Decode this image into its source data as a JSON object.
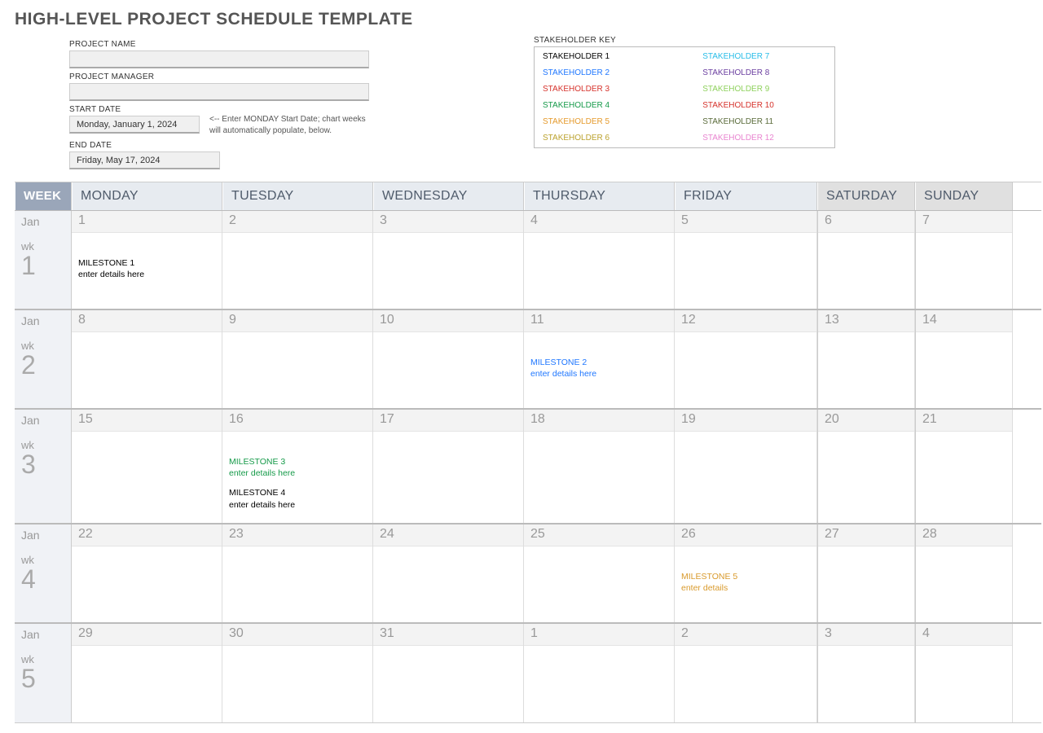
{
  "title": "HIGH-LEVEL PROJECT SCHEDULE TEMPLATE",
  "fields": {
    "project_name_label": "PROJECT NAME",
    "project_name_value": "",
    "project_manager_label": "PROJECT MANAGER",
    "project_manager_value": "",
    "start_date_label": "START DATE",
    "start_date_value": "Monday, January 1, 2024",
    "start_date_hint": "<-- Enter MONDAY Start Date; chart weeks will automatically populate, below.",
    "end_date_label": "END DATE",
    "end_date_value": "Friday, May 17, 2024"
  },
  "stakeholder_key": {
    "label": "STAKEHOLDER KEY",
    "items": [
      {
        "label": "STAKEHOLDER 1",
        "color": "#000000"
      },
      {
        "label": "STAKEHOLDER 2",
        "color": "#1f77ff"
      },
      {
        "label": "STAKEHOLDER 3",
        "color": "#d6332c"
      },
      {
        "label": "STAKEHOLDER 4",
        "color": "#159a49"
      },
      {
        "label": "STAKEHOLDER 5",
        "color": "#e59a2c"
      },
      {
        "label": "STAKEHOLDER 6",
        "color": "#bba22e"
      },
      {
        "label": "STAKEHOLDER 7",
        "color": "#29bde8"
      },
      {
        "label": "STAKEHOLDER 8",
        "color": "#6b3fa0"
      },
      {
        "label": "STAKEHOLDER 9",
        "color": "#8fd15d"
      },
      {
        "label": "STAKEHOLDER 10",
        "color": "#d6332c"
      },
      {
        "label": "STAKEHOLDER 11",
        "color": "#5a6b3a"
      },
      {
        "label": "STAKEHOLDER 12",
        "color": "#e985d0"
      }
    ]
  },
  "calendar": {
    "week_header": "WEEK",
    "days": [
      "MONDAY",
      "TUESDAY",
      "WEDNESDAY",
      "THURSDAY",
      "FRIDAY",
      "SATURDAY",
      "SUNDAY"
    ],
    "rows": [
      {
        "month": "Jan",
        "wk_label": "wk",
        "wk_num": "1",
        "cells": [
          {
            "num": "1",
            "milestones": [
              {
                "title": "MILESTONE 1",
                "details": "enter details here",
                "color": "#000000"
              }
            ]
          },
          {
            "num": "2",
            "milestones": []
          },
          {
            "num": "3",
            "milestones": []
          },
          {
            "num": "4",
            "milestones": []
          },
          {
            "num": "5",
            "milestones": []
          },
          {
            "num": "6",
            "milestones": []
          },
          {
            "num": "7",
            "milestones": []
          }
        ]
      },
      {
        "month": "Jan",
        "wk_label": "wk",
        "wk_num": "2",
        "cells": [
          {
            "num": "8",
            "milestones": []
          },
          {
            "num": "9",
            "milestones": []
          },
          {
            "num": "10",
            "milestones": []
          },
          {
            "num": "11",
            "milestones": [
              {
                "title": "MILESTONE 2",
                "details": "enter details here",
                "color": "#1f77ff"
              }
            ]
          },
          {
            "num": "12",
            "milestones": []
          },
          {
            "num": "13",
            "milestones": []
          },
          {
            "num": "14",
            "milestones": []
          }
        ]
      },
      {
        "month": "Jan",
        "wk_label": "wk",
        "wk_num": "3",
        "cells": [
          {
            "num": "15",
            "milestones": []
          },
          {
            "num": "16",
            "milestones": [
              {
                "title": "MILESTONE 3",
                "details": "enter details here",
                "color": "#159a49"
              },
              {
                "title": "MILESTONE 4",
                "details": "enter details here",
                "color": "#000000"
              }
            ]
          },
          {
            "num": "17",
            "milestones": []
          },
          {
            "num": "18",
            "milestones": []
          },
          {
            "num": "19",
            "milestones": []
          },
          {
            "num": "20",
            "milestones": []
          },
          {
            "num": "21",
            "milestones": []
          }
        ]
      },
      {
        "month": "Jan",
        "wk_label": "wk",
        "wk_num": "4",
        "cells": [
          {
            "num": "22",
            "milestones": []
          },
          {
            "num": "23",
            "milestones": []
          },
          {
            "num": "24",
            "milestones": []
          },
          {
            "num": "25",
            "milestones": []
          },
          {
            "num": "26",
            "milestones": [
              {
                "title": "MILESTONE 5",
                "details": "enter details",
                "color": "#d99a2c"
              }
            ]
          },
          {
            "num": "27",
            "milestones": []
          },
          {
            "num": "28",
            "milestones": []
          }
        ]
      },
      {
        "month": "Jan",
        "wk_label": "wk",
        "wk_num": "5",
        "cells": [
          {
            "num": "29",
            "milestones": []
          },
          {
            "num": "30",
            "milestones": []
          },
          {
            "num": "31",
            "milestones": []
          },
          {
            "num": "1",
            "milestones": []
          },
          {
            "num": "2",
            "milestones": []
          },
          {
            "num": "3",
            "milestones": []
          },
          {
            "num": "4",
            "milestones": []
          }
        ]
      }
    ]
  }
}
